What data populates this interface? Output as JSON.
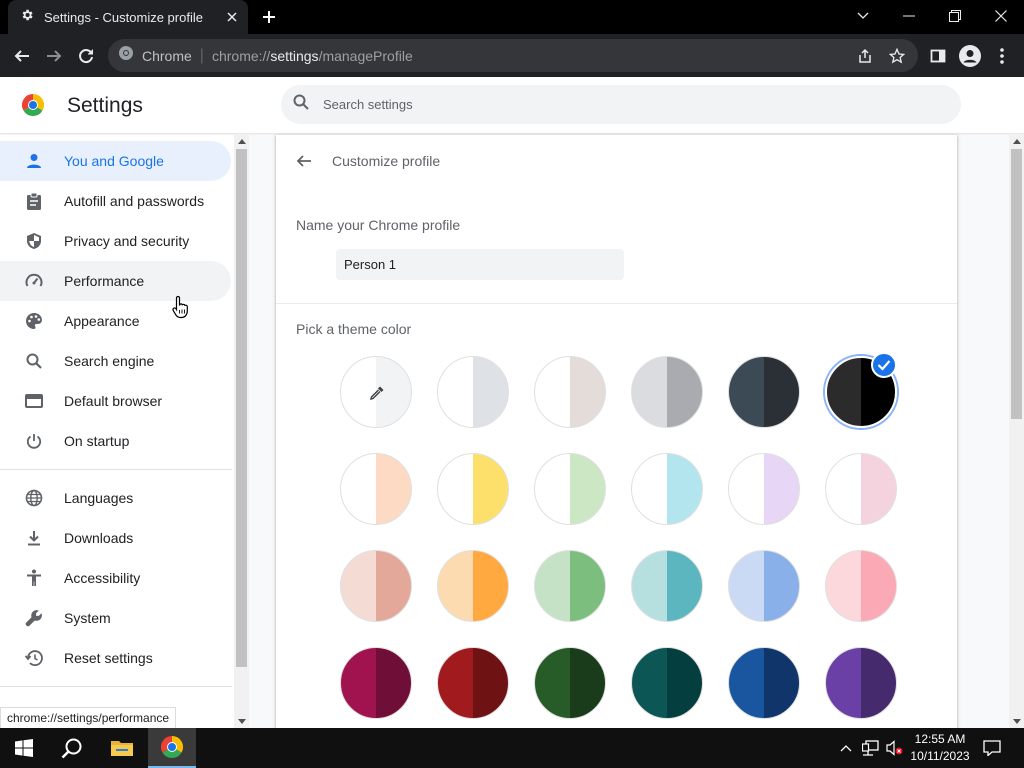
{
  "browser": {
    "tab_title": "Settings - Customize profile",
    "omnibox_site": "Chrome",
    "url_prefix": "chrome://",
    "url_host": "settings",
    "url_path": "/manageProfile"
  },
  "settings": {
    "title": "Settings",
    "search_placeholder": "Search settings"
  },
  "sidebar": {
    "items": [
      {
        "label": "You and Google",
        "icon": "person-icon"
      },
      {
        "label": "Autofill and passwords",
        "icon": "clipboard-icon"
      },
      {
        "label": "Privacy and security",
        "icon": "shield-icon"
      },
      {
        "label": "Performance",
        "icon": "speedometer-icon"
      },
      {
        "label": "Appearance",
        "icon": "palette-icon"
      },
      {
        "label": "Search engine",
        "icon": "search-icon"
      },
      {
        "label": "Default browser",
        "icon": "browser-window-icon"
      },
      {
        "label": "On startup",
        "icon": "power-icon"
      },
      {
        "label": "Languages",
        "icon": "globe-icon"
      },
      {
        "label": "Downloads",
        "icon": "download-icon"
      },
      {
        "label": "Accessibility",
        "icon": "accessibility-icon"
      },
      {
        "label": "System",
        "icon": "wrench-icon"
      },
      {
        "label": "Reset settings",
        "icon": "history-icon"
      }
    ],
    "active_item": "You and Google",
    "hovered_item": "Performance"
  },
  "customize_profile": {
    "title": "Customize profile",
    "name_label": "Name your Chrome profile",
    "name_value": "Person 1",
    "theme_label": "Pick a theme color",
    "selected_theme_index": 5,
    "themes": [
      {
        "left": "#ffffff",
        "right": "#f1f3f4",
        "type": "picker"
      },
      {
        "left": "#ffffff",
        "right": "#dee1e6"
      },
      {
        "left": "#ffffff",
        "right": "#e3dcd9"
      },
      {
        "left": "#dadce0",
        "right": "#a9abb1"
      },
      {
        "left": "#3c4a56",
        "right": "#2a3036"
      },
      {
        "left": "#2b2b2b",
        "right": "#000000"
      },
      {
        "left": "#ffffff",
        "right": "#fcdac4"
      },
      {
        "left": "#ffffff",
        "right": "#fde06b"
      },
      {
        "left": "#ffffff",
        "right": "#cce7c4"
      },
      {
        "left": "#ffffff",
        "right": "#b3e5ef"
      },
      {
        "left": "#ffffff",
        "right": "#e8d6f7"
      },
      {
        "left": "#ffffff",
        "right": "#f4d3df"
      },
      {
        "left": "#f4dcd5",
        "right": "#e3a89a"
      },
      {
        "left": "#fddbb0",
        "right": "#ffa940"
      },
      {
        "left": "#c5e2c6",
        "right": "#7cbe7d"
      },
      {
        "left": "#b6dfdf",
        "right": "#5bb6bf"
      },
      {
        "left": "#cad9f4",
        "right": "#8ab0ea"
      },
      {
        "left": "#fcd7dc",
        "right": "#fba9b5"
      },
      {
        "left": "#a1134f",
        "right": "#6f0e36"
      },
      {
        "left": "#a11a1d",
        "right": "#6e1214"
      },
      {
        "left": "#275c28",
        "right": "#1a3c1a"
      },
      {
        "left": "#0c5756",
        "right": "#053e3e"
      },
      {
        "left": "#1a56a0",
        "right": "#0f356a"
      },
      {
        "left": "#6a3fa6",
        "right": "#452a6e"
      }
    ]
  },
  "status_bar": {
    "url": "chrome://settings/performance"
  },
  "taskbar": {
    "time": "12:55 AM",
    "date": "10/11/2023"
  },
  "colors": {
    "accent": "#1a73e8",
    "active_nav_bg": "#e8f0fe",
    "taskbar": "#101010"
  }
}
